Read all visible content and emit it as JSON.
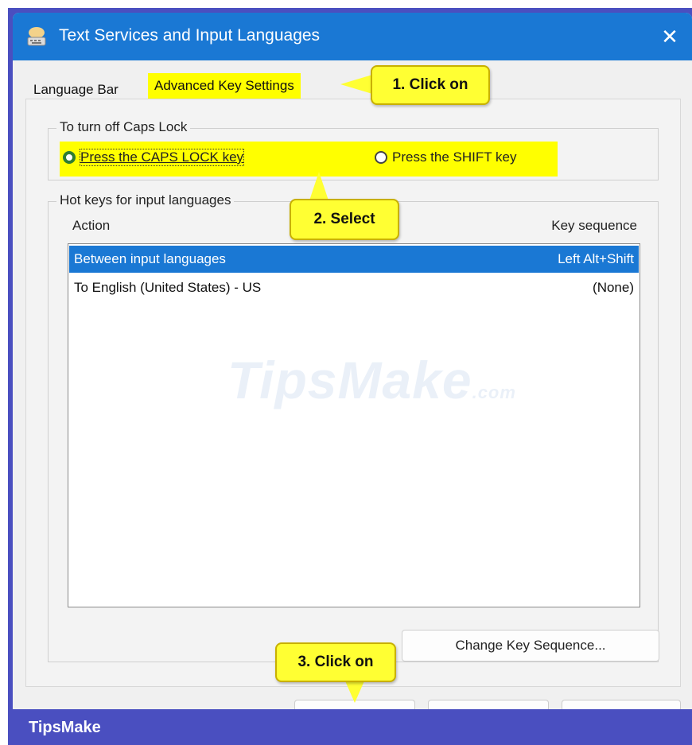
{
  "window": {
    "title": "Text Services and Input Languages",
    "close_symbol": "✕"
  },
  "tabs": [
    {
      "label": "Language Bar"
    },
    {
      "label": "Advanced Key Settings"
    }
  ],
  "caps_lock": {
    "legend": "To turn off Caps Lock",
    "options": [
      {
        "label": "Press the CAPS LOCK key",
        "checked": true
      },
      {
        "label": "Press the SHIFT key",
        "checked": false
      }
    ]
  },
  "hotkeys": {
    "legend": "Hot keys for input languages",
    "col_action": "Action",
    "col_key": "Key sequence",
    "rows": [
      {
        "action": "Between input languages",
        "key": "Left Alt+Shift",
        "selected": true
      },
      {
        "action": "To English (United States) - US",
        "key": "(None)",
        "selected": false
      }
    ],
    "change_button": "Change Key Sequence..."
  },
  "callouts": {
    "step1": "1. Click on",
    "step2": "2. Select",
    "step3": "3. Click on"
  },
  "watermark": {
    "main": "TipsMake",
    "suffix": ".com"
  },
  "footer": {
    "brand": "TipsMake"
  },
  "colors": {
    "titlebar": "#1a78d4",
    "highlight": "#ffff00",
    "callout": "#ffff33",
    "frame": "#4a4fc0",
    "selection": "#1a78d4"
  }
}
